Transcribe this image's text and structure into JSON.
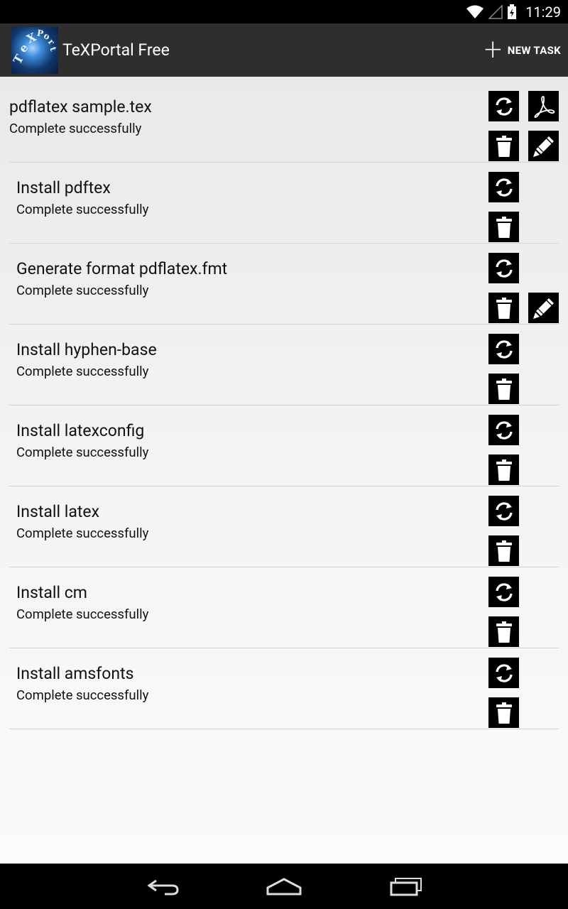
{
  "status_bar": {
    "time": "11:29"
  },
  "action_bar": {
    "title": "TeXPortal Free",
    "new_task_label": "NEW TASK",
    "logo_text": "TeXPortal"
  },
  "tasks": [
    {
      "title": "pdflatex sample.tex",
      "status": "Complete successfully",
      "actions": [
        "refresh",
        "pdf",
        "delete",
        "edit"
      ]
    },
    {
      "title": "Install pdftex",
      "status": "Complete successfully",
      "actions": [
        "refresh",
        "delete"
      ]
    },
    {
      "title": "Generate format pdflatex.fmt",
      "status": "Complete successfully",
      "actions": [
        "refresh",
        "delete",
        "edit"
      ]
    },
    {
      "title": "Install hyphen-base",
      "status": "Complete successfully",
      "actions": [
        "refresh",
        "delete"
      ]
    },
    {
      "title": "Install latexconfig",
      "status": "Complete successfully",
      "actions": [
        "refresh",
        "delete"
      ]
    },
    {
      "title": "Install latex",
      "status": "Complete successfully",
      "actions": [
        "refresh",
        "delete"
      ]
    },
    {
      "title": "Install cm",
      "status": "Complete successfully",
      "actions": [
        "refresh",
        "delete"
      ]
    },
    {
      "title": "Install amsfonts",
      "status": "Complete successfully",
      "actions": [
        "refresh",
        "delete"
      ]
    }
  ],
  "nav_bar": {
    "buttons": [
      "back-icon",
      "home-icon",
      "recent-apps-icon"
    ]
  },
  "colors": {
    "status_bar_bg": "#000000",
    "action_bar_bg": "#2e2e2e",
    "button_bg": "#000000",
    "divider": "#d2d2d2"
  }
}
